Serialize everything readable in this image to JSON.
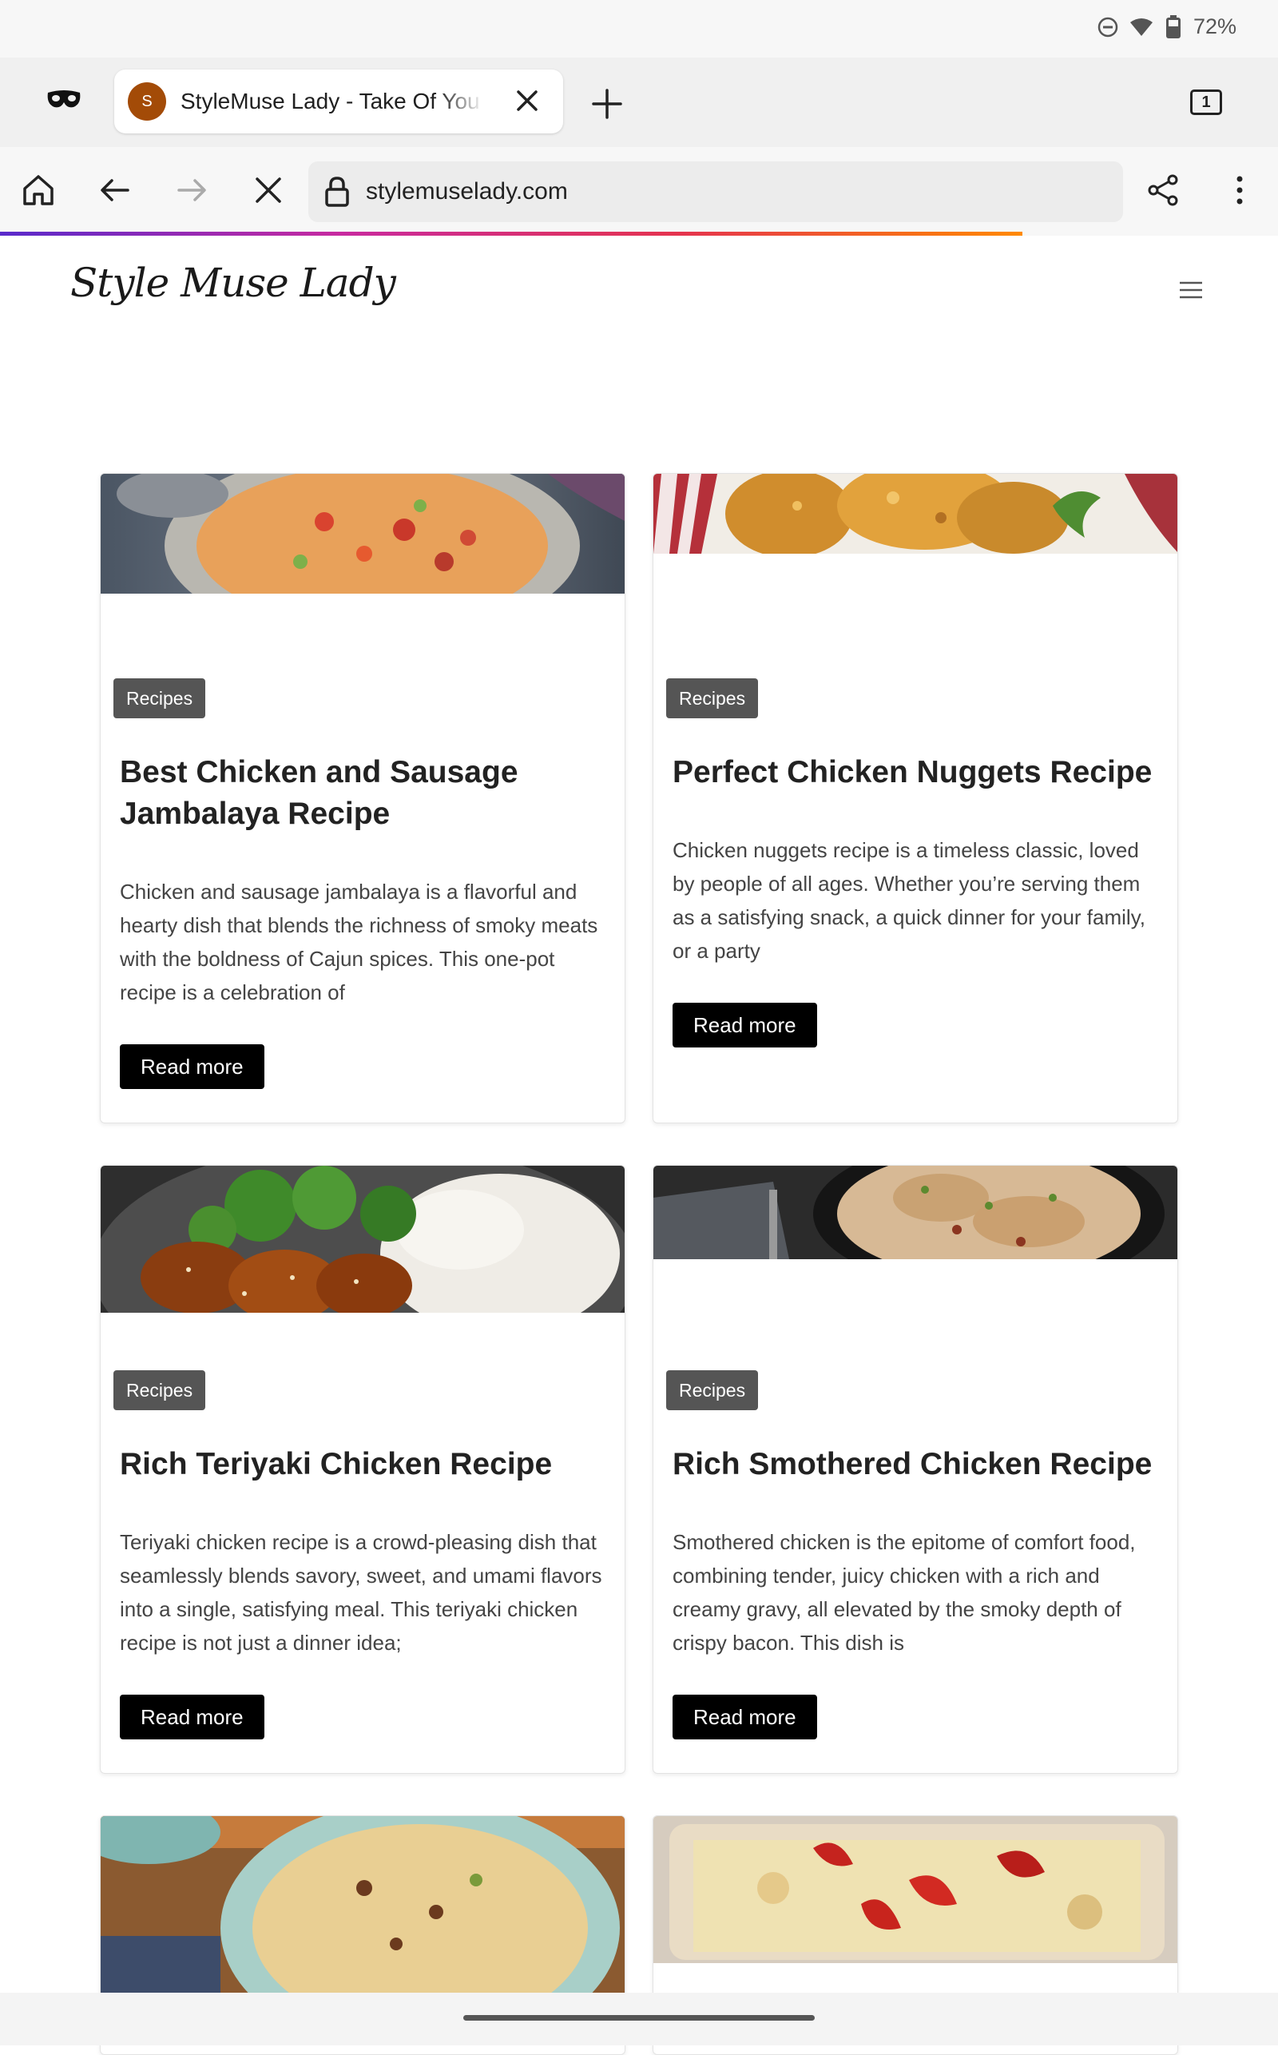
{
  "status": {
    "battery": "72%"
  },
  "browser": {
    "tab_title": "StyleMuse Lady - Take Of You",
    "favicon_letter": "S",
    "tab_count": "1",
    "url": "stylemuselady.com"
  },
  "site": {
    "logo": "Style Muse Lady"
  },
  "cards": [
    {
      "badge": "Recipes",
      "title": "Best Chicken and Sausage Jambalaya Recipe",
      "excerpt": "Chicken and sausage jambalaya is a flavorful and hearty dish that blends the richness of smoky meats with the boldness of Cajun spices. This one-pot recipe is a celebration of",
      "button": "Read more"
    },
    {
      "badge": "Recipes",
      "title": "Perfect Chicken Nuggets Recipe",
      "excerpt": "Chicken nuggets recipe is a timeless classic, loved by people of all ages. Whether you’re serving them as a satisfying snack, a quick dinner for your family, or a party",
      "button": "Read more"
    },
    {
      "badge": "Recipes",
      "title": "Rich Teriyaki Chicken Recipe",
      "excerpt": "Teriyaki chicken recipe is a crowd-pleasing dish that seamlessly blends savory, sweet, and umami flavors into a single, satisfying meal. This teriyaki chicken recipe is not just a dinner idea;",
      "button": "Read more"
    },
    {
      "badge": "Recipes",
      "title": "Rich Smothered Chicken Recipe",
      "excerpt": "Smothered chicken is the epitome of comfort food, combining tender, juicy chicken with a rich and creamy gravy, all elevated by the smoky depth of crispy bacon. This dish is",
      "button": "Read more"
    }
  ]
}
